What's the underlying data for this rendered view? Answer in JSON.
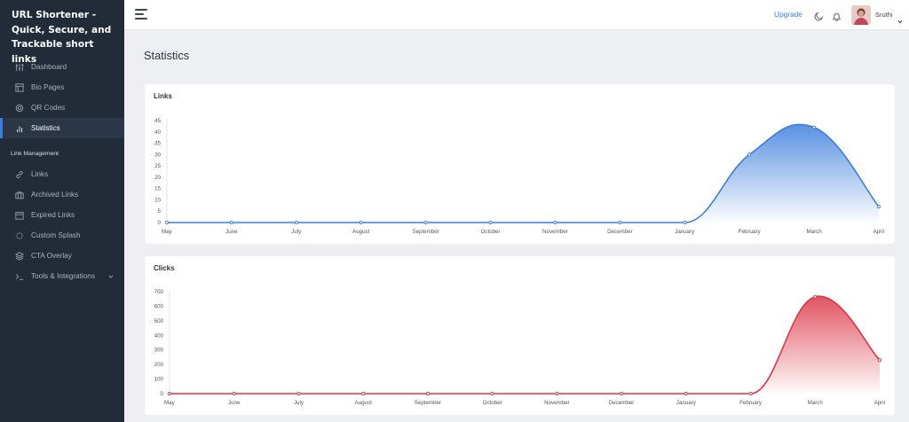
{
  "app": {
    "title": "URL Shortener - Quick, Secure, and Trackable short links"
  },
  "sidebar": {
    "items": [
      {
        "label": "Dashboard",
        "icon": "sliders-icon",
        "active": false
      },
      {
        "label": "Bio Pages",
        "icon": "layout-icon",
        "active": false
      },
      {
        "label": "QR Codes",
        "icon": "qr-icon",
        "active": false
      },
      {
        "label": "Statistics",
        "icon": "bar-chart-icon",
        "active": true
      }
    ],
    "section_header": "Link Management",
    "items2": [
      {
        "label": "Links",
        "icon": "link-icon"
      },
      {
        "label": "Archived Links",
        "icon": "briefcase-icon"
      },
      {
        "label": "Expired Links",
        "icon": "calendar-icon"
      },
      {
        "label": "Custom Splash",
        "icon": "loader-icon"
      },
      {
        "label": "CTA Overlay",
        "icon": "layers-icon"
      },
      {
        "label": "Tools & Integrations",
        "icon": "terminal-icon"
      }
    ]
  },
  "header": {
    "upgrade_label": "Upgrade",
    "user_name": "Sruthi",
    "accent_color": "#3b7ddd"
  },
  "page": {
    "title": "Statistics"
  },
  "chart_data": [
    {
      "type": "area",
      "title": "Links",
      "categories": [
        "May",
        "June",
        "July",
        "August",
        "September",
        "October",
        "November",
        "December",
        "January",
        "February",
        "March",
        "April"
      ],
      "values": [
        0,
        0,
        0,
        0,
        0,
        0,
        0,
        0,
        0,
        30,
        42,
        7
      ],
      "ylim": [
        0,
        45
      ],
      "yticks": [
        0,
        5,
        10,
        15,
        20,
        25,
        30,
        35,
        40,
        45
      ],
      "color": "#3b7ddd",
      "grid": false
    },
    {
      "type": "area",
      "title": "Clicks",
      "categories": [
        "May",
        "June",
        "July",
        "August",
        "September",
        "October",
        "November",
        "December",
        "January",
        "February",
        "March",
        "April"
      ],
      "values": [
        0,
        0,
        0,
        0,
        0,
        0,
        0,
        0,
        0,
        0,
        665,
        230
      ],
      "ylim": [
        0,
        700
      ],
      "yticks": [
        0,
        100,
        200,
        300,
        400,
        500,
        600,
        700
      ],
      "color": "#dc3545",
      "grid": false
    }
  ]
}
